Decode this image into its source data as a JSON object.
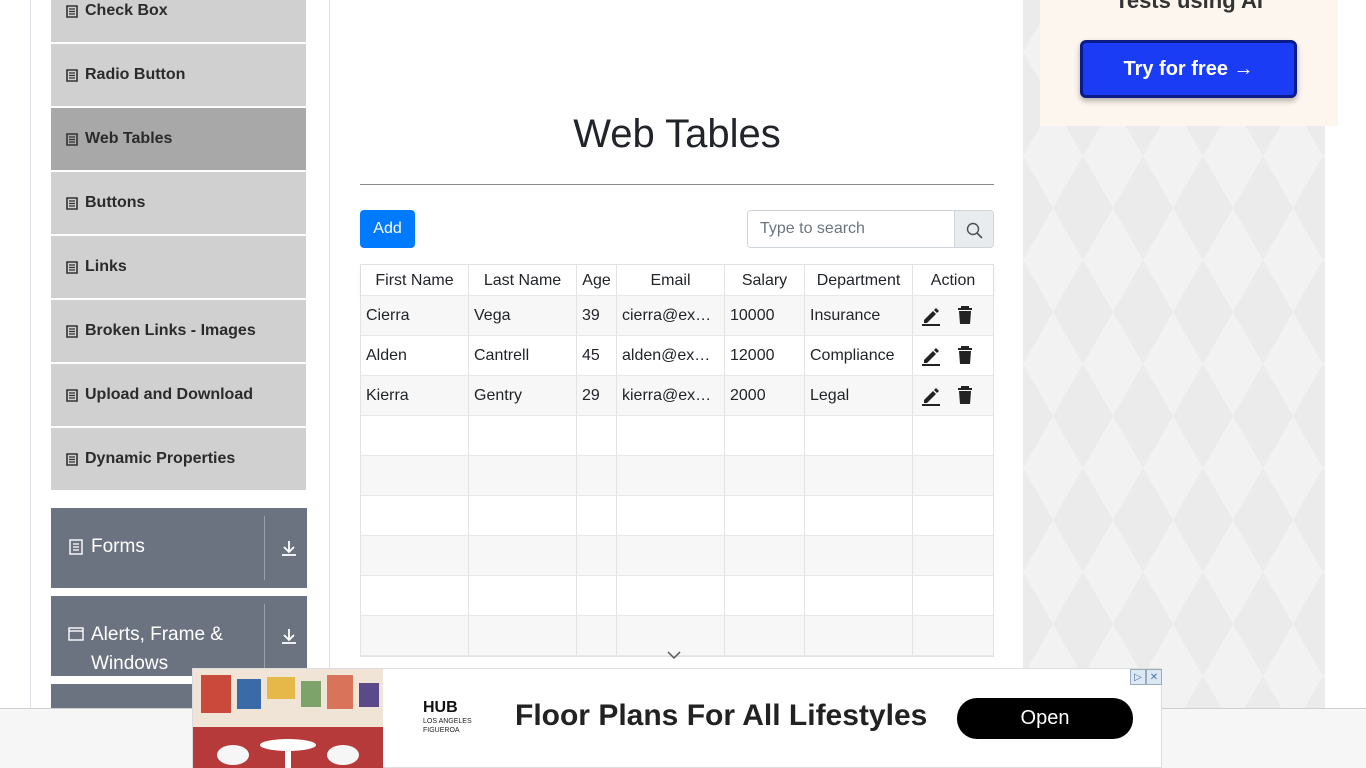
{
  "sidebar": {
    "items": [
      {
        "label": "Check Box",
        "active": false
      },
      {
        "label": "Radio Button",
        "active": false
      },
      {
        "label": "Web Tables",
        "active": true
      },
      {
        "label": "Buttons",
        "active": false
      },
      {
        "label": "Links",
        "active": false
      },
      {
        "label": "Broken Links - Images",
        "active": false
      },
      {
        "label": "Upload and Download",
        "active": false
      },
      {
        "label": "Dynamic Properties",
        "active": false
      }
    ],
    "groups": [
      {
        "label": "Forms"
      },
      {
        "label_line1": "Alerts, Frame &",
        "label_line2": "Windows"
      }
    ]
  },
  "main": {
    "title": "Web Tables",
    "add_label": "Add",
    "search_placeholder": "Type to search",
    "table": {
      "headers": [
        "First Name",
        "Last Name",
        "Age",
        "Email",
        "Salary",
        "Department",
        "Action"
      ],
      "rows": [
        [
          "Cierra",
          "Vega",
          "39",
          "cierra@ex…",
          "10000",
          "Insurance"
        ],
        [
          "Alden",
          "Cantrell",
          "45",
          "alden@ex…",
          "12000",
          "Compliance"
        ],
        [
          "Kierra",
          "Gentry",
          "29",
          "kierra@ex…",
          "2000",
          "Legal"
        ]
      ],
      "empty_rows": 7
    }
  },
  "right_ad": {
    "text": "Tests using AI",
    "button_label": "Try for free →"
  },
  "bottom_ad": {
    "brand": "HUB",
    "brand_line2": "LOS ANGELES",
    "brand_line3": "FIGUEROA",
    "headline": "Floor Plans For All Lifestyles",
    "cta": "Open"
  },
  "colors": {
    "primary": "#007bff",
    "group_bg": "#6b7380",
    "active_item": "#a8a8a8"
  }
}
